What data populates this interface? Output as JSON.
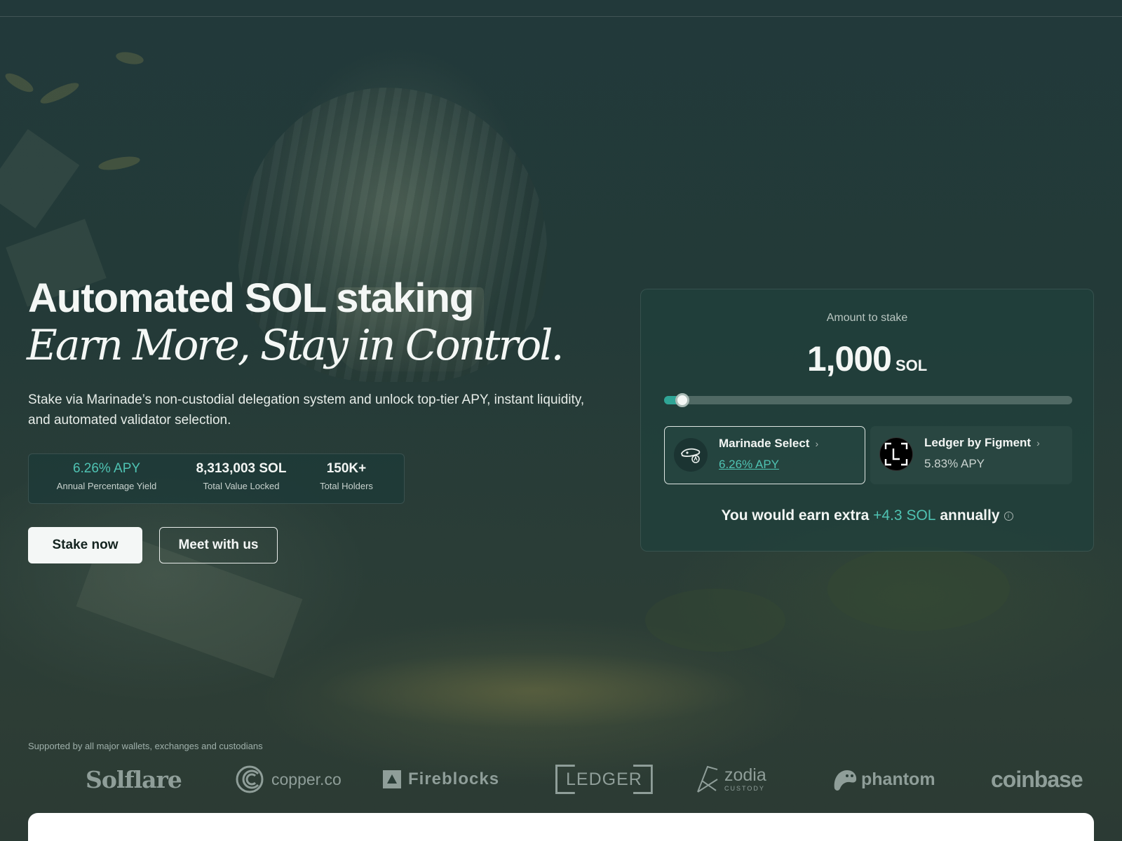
{
  "hero": {
    "title": "Automated SOL staking",
    "subtitle": "Earn More, Stay in Control.",
    "description": "Stake via Marinade’s non-custodial delegation system and unlock top-tier APY, instant liquidity, and automated validator selection."
  },
  "stats": [
    {
      "value": "6.26% APY",
      "label": "Annual Percentage Yield"
    },
    {
      "value": "8,313,003 SOL",
      "label": "Total Value Locked"
    },
    {
      "value": "150K+",
      "label": "Total Holders"
    }
  ],
  "buttons": {
    "stake_now": "Stake now",
    "meet_with_us": "Meet with us"
  },
  "stake_card": {
    "amount_label": "Amount to stake",
    "amount_value": "1,000",
    "amount_unit": "SOL",
    "slider_fraction": 0.045,
    "validators": [
      {
        "name": "Marinade Select",
        "apy": "6.26% APY",
        "selected": true
      },
      {
        "name": "Ledger by Figment",
        "apy": "5.83% APY",
        "selected": false
      }
    ],
    "earn_prefix": "You would earn extra",
    "earn_value": "+4.3 SOL",
    "earn_suffix": "annually"
  },
  "supported": {
    "label": "Supported by all major wallets, exchanges and custodians",
    "logos": {
      "solflare": "Solflare",
      "copper": "copper.co",
      "fireblocks": "Fireblocks",
      "ledger": "LEDGER",
      "zodia": "zodia",
      "zodia_sub": "CUSTODY",
      "phantom": "phantom",
      "coinbase": "coinbase"
    }
  },
  "colors": {
    "accent": "#4fc3b3",
    "slider_fill": "#2fa596",
    "background": "#22393a"
  }
}
